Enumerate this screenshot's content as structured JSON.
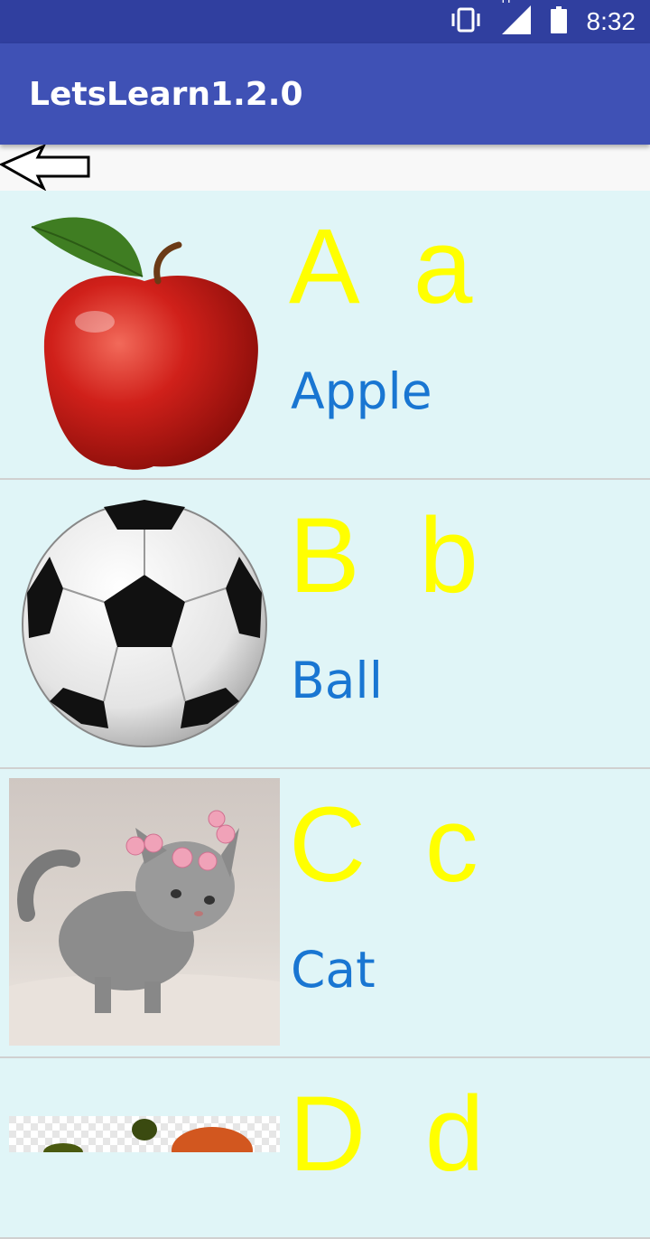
{
  "status_bar": {
    "time": "8:32",
    "network": "H",
    "icons": [
      "vibrate-icon",
      "signal-icon",
      "battery-icon"
    ]
  },
  "app_bar": {
    "title": "LetsLearn1.2.0"
  },
  "nav": {
    "back_icon": "arrow-left-icon"
  },
  "items": [
    {
      "letters": "A  a",
      "word": "Apple",
      "image": "apple"
    },
    {
      "letters": "B  b",
      "word": "Ball",
      "image": "soccer-ball"
    },
    {
      "letters": "C  c",
      "word": "Cat",
      "image": "kitten"
    },
    {
      "letters": "D  d",
      "word": "",
      "image": "partial"
    }
  ],
  "colors": {
    "status_bar": "#303f9f",
    "app_bar": "#3f51b5",
    "list_bg": "#e0f5f7",
    "letters": "#ffff00",
    "word": "#1976d2"
  }
}
